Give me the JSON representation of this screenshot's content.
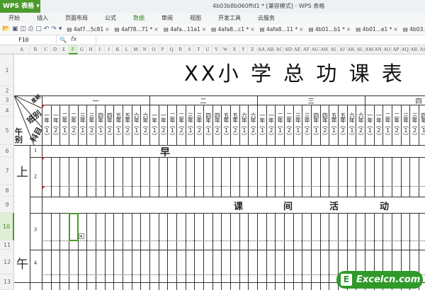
{
  "app": {
    "name": "WPS 表格",
    "doc_title": "4b03b8b060ffd1 * [兼容模式] - WPS 表格"
  },
  "menu": [
    "开始",
    "插入",
    "页面布局",
    "公式",
    "数据",
    "审阅",
    "视图",
    "开发工具",
    "云服务"
  ],
  "menu_active": "数据",
  "doc_tabs": [
    "4af7...5c81",
    "4af78...71 *",
    "4afa...11a1",
    "4afa8...c1 *",
    "4afa8...11 *",
    "4b01...b1 *",
    "4b01...e1 *",
    "4b03..."
  ],
  "formula_bar": {
    "name_box": "F10",
    "fx": "fx",
    "value": ""
  },
  "column_letters": [
    "A",
    "B",
    "C",
    "D",
    "E",
    "F",
    "G",
    "H",
    "I",
    "J",
    "K",
    "L",
    "M",
    "N",
    "O",
    "P",
    "Q",
    "R",
    "S",
    "T",
    "U",
    "V",
    "W",
    "X",
    "Y",
    "Z",
    "AA",
    "AB",
    "AC",
    "AD",
    "AE",
    "AF",
    "AG",
    "AH",
    "AI",
    "AJ",
    "AK",
    "AL",
    "AM",
    "AN",
    "AO",
    "AP",
    "AQ",
    "AR",
    "AS"
  ],
  "selected_column": "F",
  "row_numbers": [
    "1",
    "2",
    "3",
    "4",
    "5",
    "6",
    "7",
    "8",
    "9",
    "10",
    "11",
    "12",
    "13"
  ],
  "selected_row": "10",
  "sheet": {
    "title": "XX小 学 总 功 课 表",
    "header_corner": {
      "day": "星期",
      "class": "班别",
      "subject": "科目",
      "period": "午别"
    },
    "days": [
      "一",
      "二",
      "三",
      "四"
    ],
    "classes": [
      "一年（1）",
      "一年（2）",
      "二年（1）",
      "二年（2）",
      "三年（1）",
      "三年（2）",
      "四年（1）",
      "四年（2）",
      "五年（1）",
      "五年（2）",
      "六年（1）",
      "六年（2）"
    ],
    "morning_label": [
      "上",
      "午"
    ],
    "periods": [
      "1",
      "2",
      "3",
      "4"
    ],
    "row6_text": "早",
    "row9_text": [
      "课",
      "间",
      "活",
      "动"
    ]
  },
  "watermark": {
    "letter": "E",
    "text": "Excelcn.com"
  },
  "colors": {
    "accent": "#4b9a2d"
  }
}
